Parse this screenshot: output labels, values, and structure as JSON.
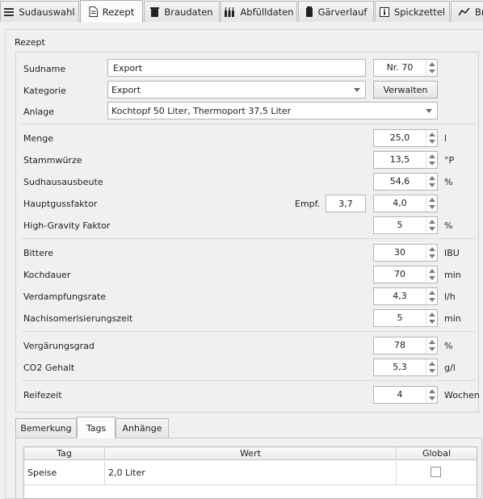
{
  "tabs": [
    {
      "label": "Sudauswahl",
      "icon": "hamburger-menu-icon"
    },
    {
      "label": "Rezept",
      "icon": "document-icon"
    },
    {
      "label": "Braudaten",
      "icon": "kettle-icon"
    },
    {
      "label": "Abfülldaten",
      "icon": "bottles-icon"
    },
    {
      "label": "Gärverlauf",
      "icon": "fermenter-icon"
    },
    {
      "label": "Spickzettel",
      "icon": "info-note-icon"
    },
    {
      "label": "Br",
      "icon": "chart-icon"
    }
  ],
  "section_title": "Rezept",
  "fields": {
    "sudname": {
      "label": "Sudname",
      "value": "Export",
      "number": "Nr. 70"
    },
    "kategorie": {
      "label": "Kategorie",
      "value": "Export",
      "button": "Verwalten"
    },
    "anlage": {
      "label": "Anlage",
      "value": "Kochtopf 50 Liter, Thermoport 37,5 Liter"
    },
    "menge": {
      "label": "Menge",
      "value": "25,0",
      "unit": "l"
    },
    "stammwuerze": {
      "label": "Stammwürze",
      "value": "13,5",
      "unit": "°P"
    },
    "sudhausausbeute": {
      "label": "Sudhausausbeute",
      "value": "54,6",
      "unit": "%"
    },
    "hauptguss": {
      "label": "Hauptgussfaktor",
      "empf_label": "Empf.",
      "empf_value": "3,7",
      "value": "4,0"
    },
    "high_gravity": {
      "label": "High-Gravity Faktor",
      "value": "5",
      "unit": "%"
    },
    "bittere": {
      "label": "Bittere",
      "value": "30",
      "unit": "IBU"
    },
    "kochdauer": {
      "label": "Kochdauer",
      "value": "70",
      "unit": "min"
    },
    "verdampfung": {
      "label": "Verdampfungsrate",
      "value": "4,3",
      "unit": "l/h"
    },
    "nachiso": {
      "label": "Nachisomerisierungszeit",
      "value": "5",
      "unit": "min"
    },
    "vergaerung": {
      "label": "Vergärungsgrad",
      "value": "78",
      "unit": "%"
    },
    "co2": {
      "label": "CO2 Gehalt",
      "value": "5,3",
      "unit": "g/l"
    },
    "reifezeit": {
      "label": "Reifezeit",
      "value": "4",
      "unit": "Wochen"
    }
  },
  "bottom_tabs": [
    "Bemerkung",
    "Tags",
    "Anhänge"
  ],
  "table": {
    "headers": [
      "Tag",
      "Wert",
      "Global"
    ],
    "rows": [
      {
        "tag": "Speise",
        "wert": "2,0 Liter",
        "global": false
      }
    ]
  }
}
